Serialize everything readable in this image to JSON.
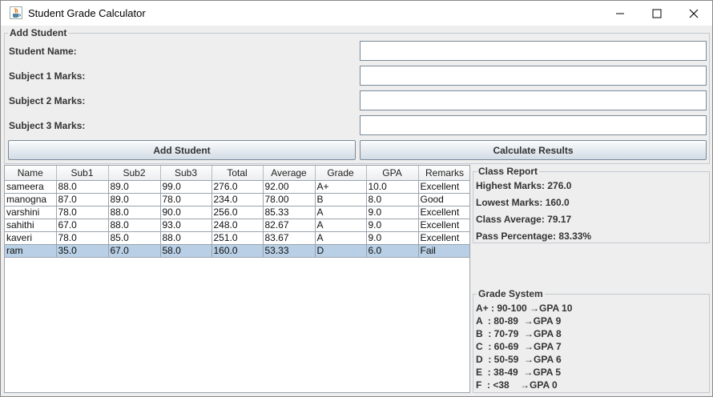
{
  "window": {
    "title": "Student Grade Calculator",
    "minimize_glyph": "minimize-icon",
    "maximize_glyph": "maximize-icon",
    "close_glyph": "close-icon"
  },
  "add_student_panel": {
    "title": "Add Student",
    "fields": [
      {
        "label": "Student Name:",
        "value": ""
      },
      {
        "label": "Subject 1 Marks:",
        "value": ""
      },
      {
        "label": "Subject 2 Marks:",
        "value": ""
      },
      {
        "label": "Subject 3 Marks:",
        "value": ""
      }
    ],
    "add_button": "Add Student",
    "calculate_button": "Calculate Results"
  },
  "table": {
    "columns": [
      "Name",
      "Sub1",
      "Sub2",
      "Sub3",
      "Total",
      "Average",
      "Grade",
      "GPA",
      "Remarks"
    ],
    "rows": [
      [
        "sameera",
        "88.0",
        "89.0",
        "99.0",
        "276.0",
        "92.00",
        "A+",
        "10.0",
        "Excellent"
      ],
      [
        "manogna",
        "87.0",
        "89.0",
        "78.0",
        "234.0",
        "78.00",
        "B",
        "8.0",
        "Good"
      ],
      [
        "varshini",
        "78.0",
        "88.0",
        "90.0",
        "256.0",
        "85.33",
        "A",
        "9.0",
        "Excellent"
      ],
      [
        "sahithi",
        "67.0",
        "88.0",
        "93.0",
        "248.0",
        "82.67",
        "A",
        "9.0",
        "Excellent"
      ],
      [
        "kaveri",
        "78.0",
        "85.0",
        "88.0",
        "251.0",
        "83.67",
        "A",
        "9.0",
        "Excellent"
      ],
      [
        "ram",
        "35.0",
        "67.0",
        "58.0",
        "160.0",
        "53.33",
        "D",
        "6.0",
        "Fail"
      ]
    ],
    "selected_row": 5
  },
  "class_report": {
    "title": "Class Report",
    "lines": [
      "Highest Marks: 276.0",
      "Lowest Marks: 160.0",
      "Class Average: 79.17",
      "Pass Percentage: 83.33%"
    ]
  },
  "grade_system": {
    "title": "Grade System",
    "lines": [
      "A+ : 90-100 →GPA 10",
      "A  : 80-89  →GPA 9",
      "B  : 70-79  →GPA 8",
      "C  : 60-69  →GPA 7",
      "D  : 50-59  →GPA 6",
      "E  : 38-49  →GPA 5",
      "F  : <38    →GPA 0"
    ]
  },
  "colors": {
    "window_bg": "#eeeeee",
    "selection": "#b8cfe5",
    "grid_line": "#9aa3ad"
  }
}
